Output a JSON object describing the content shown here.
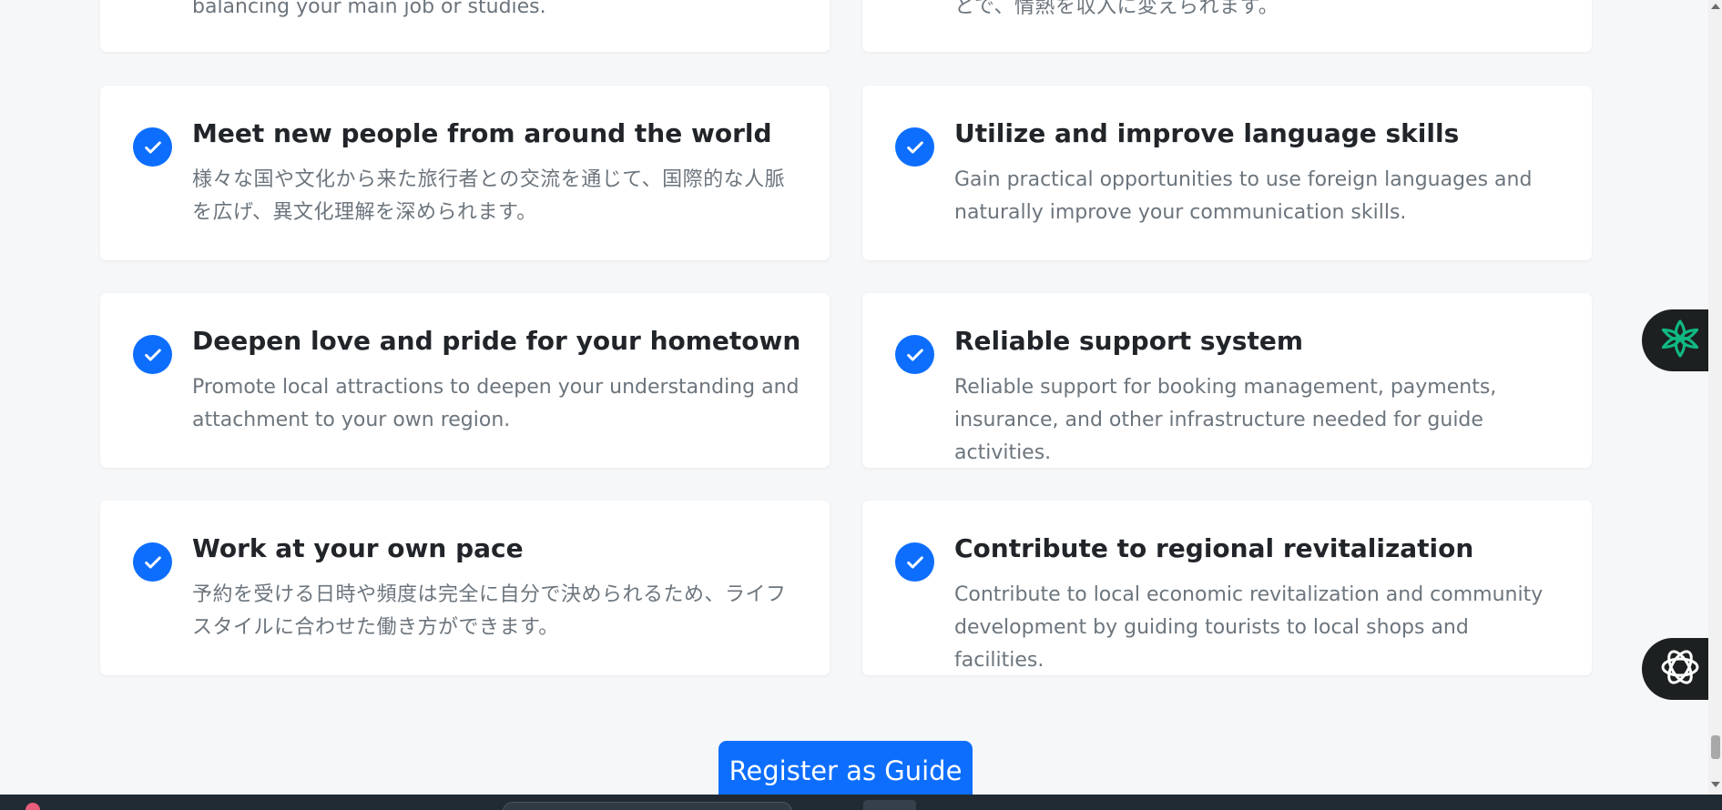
{
  "cards": {
    "top_left_partial": {
      "desc": "balancing your main job or studies."
    },
    "top_right_partial": {
      "desc": "とで、情熱を収入に変えられます。"
    },
    "meet_people": {
      "title": "Meet new people from around the world",
      "desc": "様々な国や文化から来た旅行者との交流を通じて、国際的な人脈を広げ、異文化理解を深められます。"
    },
    "language_skills": {
      "title": "Utilize and improve language skills",
      "desc": "Gain practical opportunities to use foreign languages and naturally improve your communication skills."
    },
    "hometown": {
      "title": "Deepen love and pride for your hometown",
      "desc": "Promote local attractions to deepen your understanding and attachment to your own region."
    },
    "support": {
      "title": "Reliable support system",
      "desc": "Reliable support for booking management, payments, insurance, and other infrastructure needed for guide activities."
    },
    "own_pace": {
      "title": "Work at your own pace",
      "desc": "予約を受ける日時や頻度は完全に自分で決められるため、ライフスタイルに合わせた働き方ができます。"
    },
    "revitalization": {
      "title": "Contribute to regional revitalization",
      "desc": "Contribute to local economic revitalization and community development by guiding tourists to local shops and facilities."
    }
  },
  "cta": {
    "register_label": "Register as Guide"
  },
  "widgets": {
    "top_icon": "ai-assistant-icon",
    "bottom_icon": "openai-logo-icon"
  },
  "colors": {
    "accent": "#0d6efd",
    "background": "#f6f7f9",
    "widget_green": "#10b981"
  }
}
